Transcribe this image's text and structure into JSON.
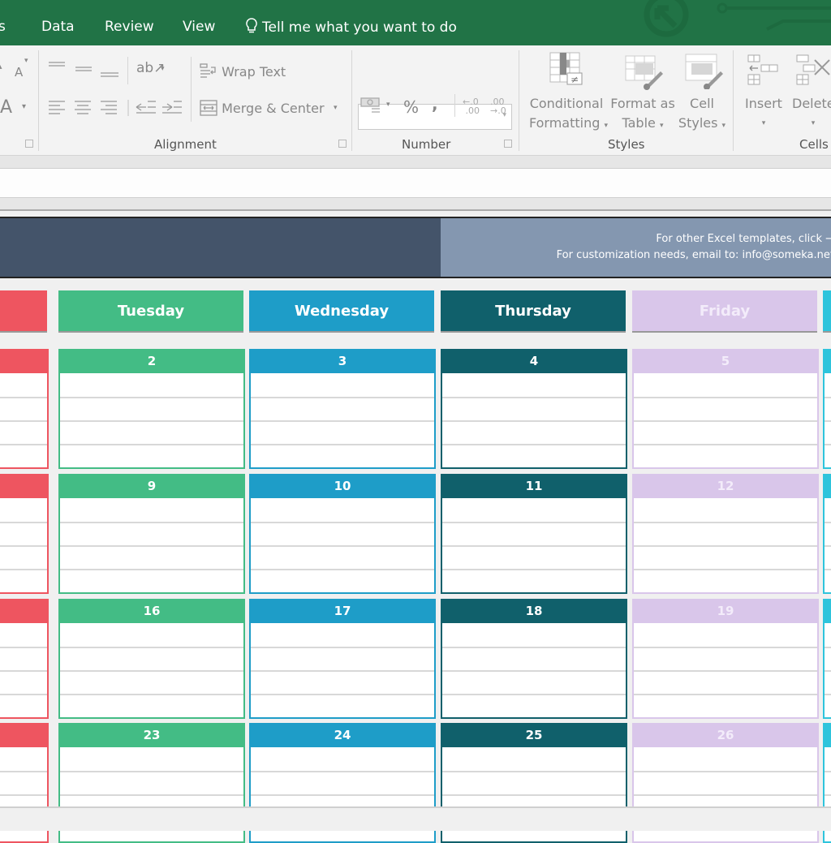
{
  "ribbon_tabs": [
    {
      "label": "s"
    },
    {
      "label": "Data"
    },
    {
      "label": "Review"
    },
    {
      "label": "View"
    }
  ],
  "tell_me": {
    "icon": "lightbulb-icon",
    "label": "Tell me what you want to do"
  },
  "ribbon": {
    "font": {
      "grow_label": "A",
      "color_label": "A"
    },
    "alignment": {
      "wrap_text": "Wrap Text",
      "merge_center": "Merge & Center",
      "group_label": "Alignment"
    },
    "number": {
      "format_value": "",
      "percent": "%",
      "comma": ",",
      "inc_decimal": "←.0 .00",
      "dec_decimal": ".00 →.0",
      "group_label": "Number"
    },
    "styles": {
      "conditional_formatting": [
        "Conditional",
        "Formatting"
      ],
      "format_as_table": [
        "Format as",
        "Table"
      ],
      "cell_styles": [
        "Cell",
        "Styles"
      ],
      "group_label": "Styles"
    },
    "cells": {
      "insert": "Insert",
      "delete": "Delete",
      "group_label": "Cells"
    }
  },
  "banner": {
    "line1": "For other Excel templates, click →",
    "line2": "For customization needs, email to: info@someka.net"
  },
  "colors": {
    "monday": "#ee5560",
    "tuesday": "#43bc85",
    "wednesday": "#1e9dc8",
    "thursday": "#10606b",
    "friday": "#d9c6ea",
    "saturday": "#2ec4dc",
    "excel_green": "#217346"
  },
  "days": [
    {
      "key": "monday",
      "label": ""
    },
    {
      "key": "tuesday",
      "label": "Tuesday"
    },
    {
      "key": "wednesday",
      "label": "Wednesday"
    },
    {
      "key": "thursday",
      "label": "Thursday"
    },
    {
      "key": "friday",
      "label": "Friday"
    },
    {
      "key": "saturday",
      "label": ""
    }
  ],
  "weeks": [
    [
      "",
      "2",
      "3",
      "4",
      "5",
      ""
    ],
    [
      "",
      "9",
      "10",
      "11",
      "12",
      ""
    ],
    [
      "",
      "16",
      "17",
      "18",
      "19",
      ""
    ],
    [
      "",
      "23",
      "24",
      "25",
      "26",
      ""
    ]
  ]
}
